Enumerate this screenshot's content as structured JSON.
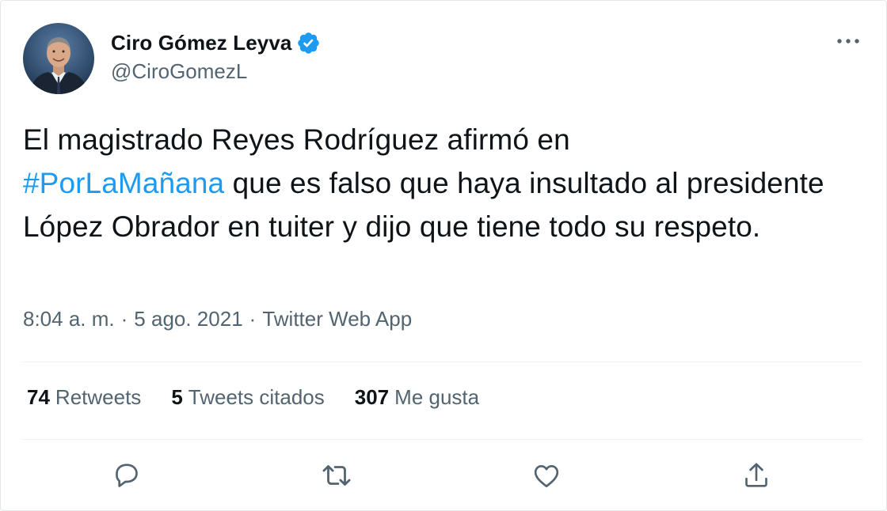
{
  "author": {
    "display_name": "Ciro Gómez Leyva",
    "handle": "@CiroGomezL",
    "verified": true,
    "avatar_icon": "profile-photo"
  },
  "tweet": {
    "text_before": "El magistrado Reyes Rodríguez afirmó en",
    "hashtag": "#PorLaMañana",
    "text_after": " que es falso que haya insultado al presidente López Obrador en tuiter y dijo que tiene todo su respeto."
  },
  "meta": {
    "time": "8:04 a. m.",
    "separator": "·",
    "date": "5 ago. 2021",
    "source": "Twitter Web App"
  },
  "stats": {
    "retweets_count": "74",
    "retweets_label": "Retweets",
    "quotes_count": "5",
    "quotes_label": "Tweets citados",
    "likes_count": "307",
    "likes_label": "Me gusta"
  },
  "actions": [
    "reply-icon",
    "retweet-icon",
    "like-icon",
    "share-icon"
  ],
  "colors": {
    "accent": "#1d9bf0",
    "text_primary": "#0f1419",
    "text_secondary": "#536471",
    "divider": "#eff3f4"
  }
}
